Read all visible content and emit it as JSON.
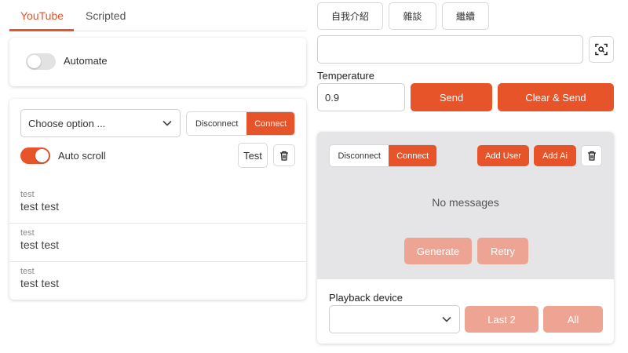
{
  "tabs": [
    {
      "label": "YouTube",
      "active": true
    },
    {
      "label": "Scripted",
      "active": false
    }
  ],
  "automate": {
    "label": "Automate",
    "enabled": false
  },
  "left_panel": {
    "select_value": "Choose option ...",
    "disconnect_label": "Disconnect",
    "connect_label": "Connect",
    "autoscroll_label": "Auto scroll",
    "autoscroll_enabled": true,
    "test_label": "Test",
    "messages": [
      {
        "title": "test",
        "body": "test test"
      },
      {
        "title": "test",
        "body": "test test"
      },
      {
        "title": "test",
        "body": "test test"
      }
    ]
  },
  "quick_buttons": [
    "自我介紹",
    "雜談",
    "繼續"
  ],
  "prompt_input": {
    "value": "",
    "placeholder": ""
  },
  "temperature": {
    "label": "Temperature",
    "value": "0.9"
  },
  "send_label": "Send",
  "clear_send_label": "Clear & Send",
  "chat_panel": {
    "disconnect_label": "Disconnect",
    "connect_label": "Connect",
    "add_user_label": "Add User",
    "add_ai_label": "Add Ai",
    "empty_label": "No messages",
    "generate_label": "Generate",
    "retry_label": "Retry",
    "playback_label": "Playback device",
    "playback_value": "",
    "last2_label": "Last 2",
    "all_label": "All"
  },
  "colors": {
    "accent": "#e8542a",
    "accent_faded": "#eea493",
    "panel_bg": "#e5e5e7"
  },
  "icons": [
    "trash-icon",
    "scan-search-icon",
    "chevron-down-icon"
  ]
}
